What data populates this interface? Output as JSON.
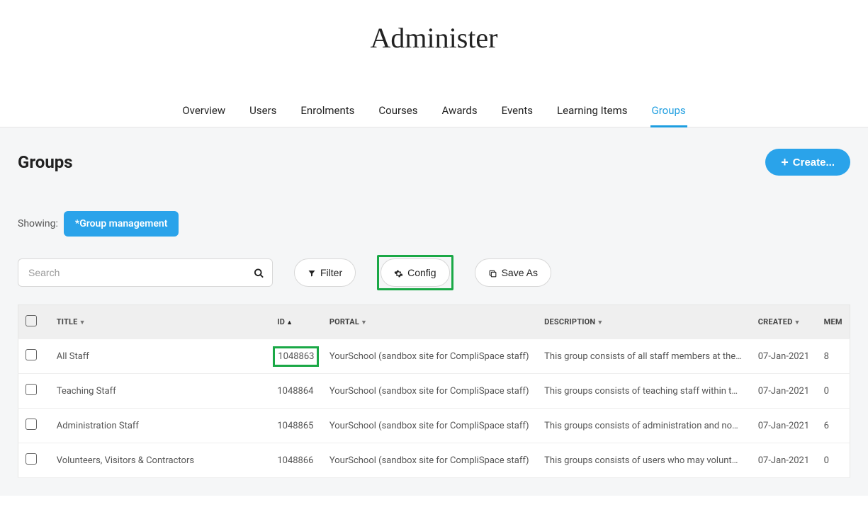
{
  "page": {
    "title": "Administer"
  },
  "tabs": [
    {
      "label": "Overview"
    },
    {
      "label": "Users"
    },
    {
      "label": "Enrolments"
    },
    {
      "label": "Courses"
    },
    {
      "label": "Awards"
    },
    {
      "label": "Events"
    },
    {
      "label": "Learning Items"
    },
    {
      "label": "Groups",
      "active": true
    }
  ],
  "section": {
    "heading": "Groups",
    "create_label": "Create..."
  },
  "showing": {
    "label": "Showing:",
    "chip": "*Group management"
  },
  "search": {
    "placeholder": "Search"
  },
  "buttons": {
    "filter": "Filter",
    "config": "Config",
    "saveas": "Save As"
  },
  "table": {
    "headers": {
      "title": "TITLE",
      "id": "ID",
      "portal": "PORTAL",
      "description": "DESCRIPTION",
      "created": "CREATED",
      "members": "MEM"
    },
    "rows": [
      {
        "title": "All Staff",
        "id": "1048863",
        "portal": "YourSchool (sandbox site for CompliSpace staff)",
        "description": "This group consists of all staff members at the sc...",
        "created": "07-Jan-2021",
        "members": "8",
        "highlight_id": true
      },
      {
        "title": "Teaching Staff",
        "id": "1048864",
        "portal": "YourSchool (sandbox site for CompliSpace staff)",
        "description": "This groups consists of teaching staff within the...",
        "created": "07-Jan-2021",
        "members": "0"
      },
      {
        "title": "Administration Staff",
        "id": "1048865",
        "portal": "YourSchool (sandbox site for CompliSpace staff)",
        "description": "This groups consists of administration and non-tea...",
        "created": "07-Jan-2021",
        "members": "6"
      },
      {
        "title": "Volunteers, Visitors & Contractors",
        "id": "1048866",
        "portal": "YourSchool (sandbox site for CompliSpace staff)",
        "description": "This groups consists of users who may volunteer, v...",
        "created": "07-Jan-2021",
        "members": "0"
      }
    ]
  }
}
